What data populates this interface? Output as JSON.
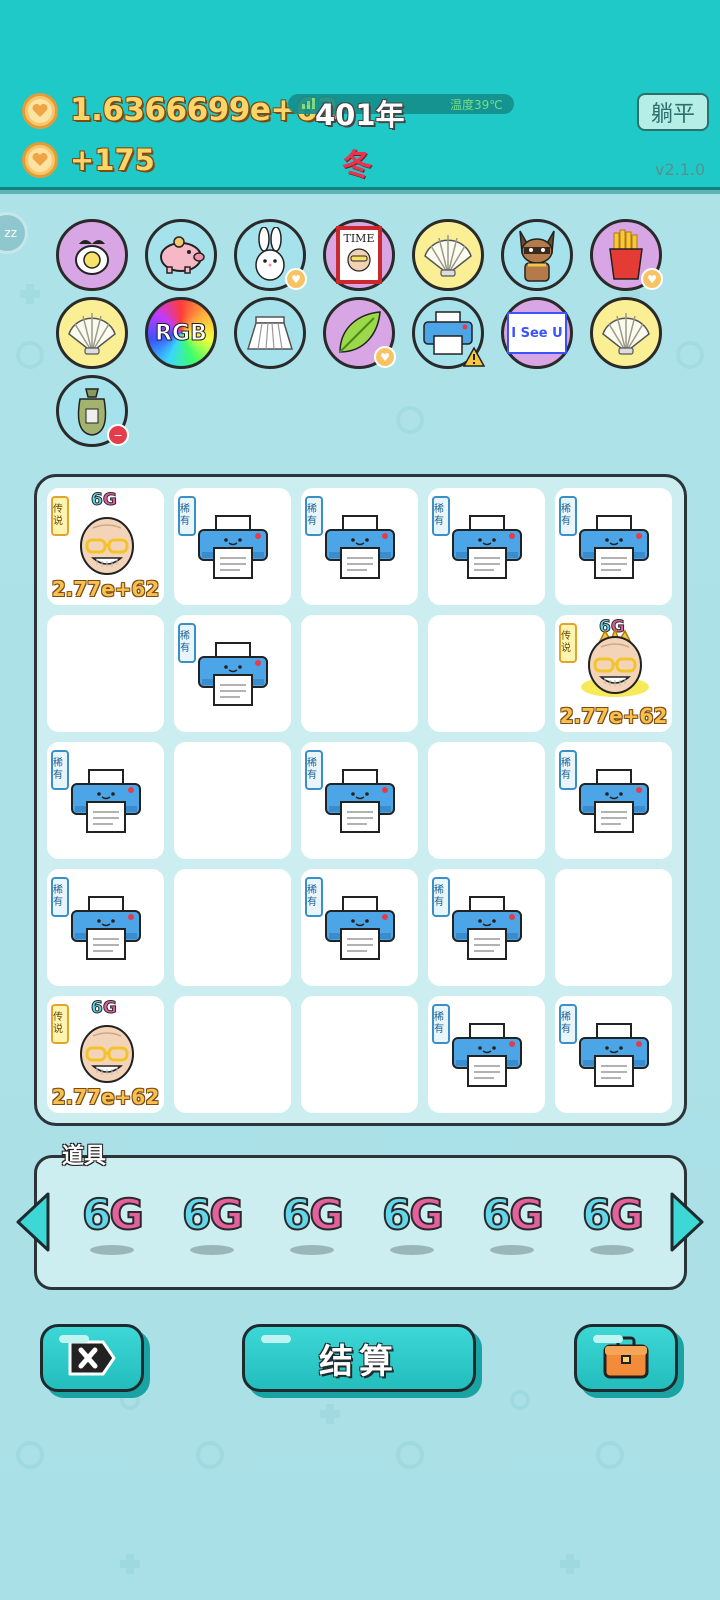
{
  "header": {
    "money": "1.6366699e+62",
    "income": "+175",
    "year": "401年",
    "season": "冬",
    "status_text": "温度39℃",
    "flat_button": "躺平",
    "version": "v2.1.0"
  },
  "zz_badge": "zz",
  "symbols": [
    {
      "icon": "egg-bowl-icon",
      "bg": "purple"
    },
    {
      "icon": "piggy-bank-icon",
      "bg": "teal"
    },
    {
      "icon": "bunny-icon",
      "bg": "teal",
      "tag": "heart"
    },
    {
      "icon": "time-magazine-icon",
      "bg": "purple"
    },
    {
      "icon": "shell-icon",
      "bg": "yellow"
    },
    {
      "icon": "raccoon-icon",
      "bg": "teal"
    },
    {
      "icon": "fries-icon",
      "bg": "purple",
      "tag": "heart"
    },
    {
      "icon": "shell-icon",
      "bg": "yellow"
    },
    {
      "icon": "rgb-icon",
      "bg": "rgb",
      "label": "RGB"
    },
    {
      "icon": "skirt-icon",
      "bg": "teal"
    },
    {
      "icon": "leaf-icon",
      "bg": "purple",
      "tag": "heart"
    },
    {
      "icon": "printer-icon",
      "bg": "teal",
      "tag": "warn"
    },
    {
      "icon": "i-see-u-icon",
      "bg": "purple",
      "label": "I See U"
    },
    {
      "icon": "shell-icon",
      "bg": "yellow"
    },
    {
      "icon": "sack-icon",
      "bg": "teal",
      "tag": "remove"
    }
  ],
  "board": {
    "rare_label": "稀有",
    "legend_label": "传说",
    "sixg_six": "6",
    "sixg_g": "G",
    "score": "2.77e+62",
    "cells": [
      "legend",
      "rare",
      "rare",
      "rare",
      "rare",
      "empty",
      "rare",
      "empty",
      "empty",
      "legend-crown",
      "rare",
      "empty",
      "rare",
      "empty",
      "rare",
      "rare",
      "empty",
      "rare",
      "rare",
      "empty",
      "legend",
      "empty",
      "empty",
      "rare",
      "rare"
    ]
  },
  "items": {
    "title": "道具",
    "cards": [
      "6G",
      "6G",
      "6G",
      "6G",
      "6G",
      "6G"
    ]
  },
  "buttons": {
    "settle": "结算"
  },
  "colors": {
    "header": "#1fc9c7",
    "board_bg": "#cdeef0",
    "coin": "#f7c867",
    "accent_pink": "#e55da0",
    "accent_cyan": "#62d6ea"
  }
}
